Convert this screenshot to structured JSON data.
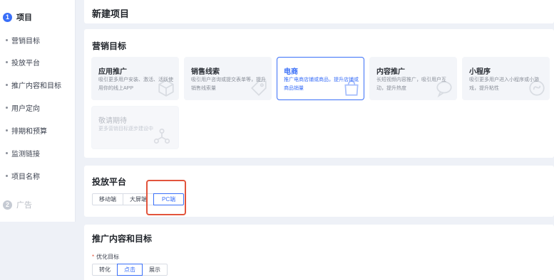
{
  "sidebar": {
    "step1": {
      "num": "1",
      "label": "项目"
    },
    "items": [
      {
        "label": "营销目标"
      },
      {
        "label": "投放平台"
      },
      {
        "label": "推广内容和目标"
      },
      {
        "label": "用户定向"
      },
      {
        "label": "排期和预算"
      },
      {
        "label": "监测链接"
      },
      {
        "label": "项目名称"
      }
    ],
    "step2": {
      "num": "2",
      "label": "广告"
    }
  },
  "header": {
    "title": "新建项目"
  },
  "marketing": {
    "title": "营销目标",
    "tiles": [
      {
        "title": "应用推广",
        "desc": "吸引更多用户安装、激活、活跃使用你的线上APP",
        "icon": "cube-icon",
        "state": "normal"
      },
      {
        "title": "销售线索",
        "desc": "吸引用户咨询或提交表单等，提升销售线索量",
        "icon": "tag-icon",
        "state": "normal"
      },
      {
        "title": "电商",
        "desc": "推广电商店铺或商品，提升店铺或商品销量",
        "icon": "shopping-bag-icon",
        "state": "selected"
      },
      {
        "title": "内容推广",
        "desc": "长短视频内容推广，吸引用户互动，提升热度",
        "icon": "chat-icon",
        "state": "normal"
      },
      {
        "title": "小程序",
        "desc": "吸引更多用户进入小程序或小游戏，提升粘性",
        "icon": "miniprogram-icon",
        "state": "normal"
      },
      {
        "title": "敬请期待",
        "desc": "更多营销目标逐步建设中",
        "icon": "network-icon",
        "state": "disabled"
      }
    ]
  },
  "platform": {
    "title": "投放平台",
    "options": [
      "移动端",
      "大屏端",
      "PC端"
    ],
    "selected": "PC端"
  },
  "content": {
    "title": "推广内容和目标",
    "field_label": "优化目标",
    "required_mark": "*",
    "options": [
      "转化",
      "点击",
      "展示"
    ],
    "selected": "点击"
  },
  "colors": {
    "accent": "#3a6ff8",
    "highlight": "#e2543c"
  }
}
